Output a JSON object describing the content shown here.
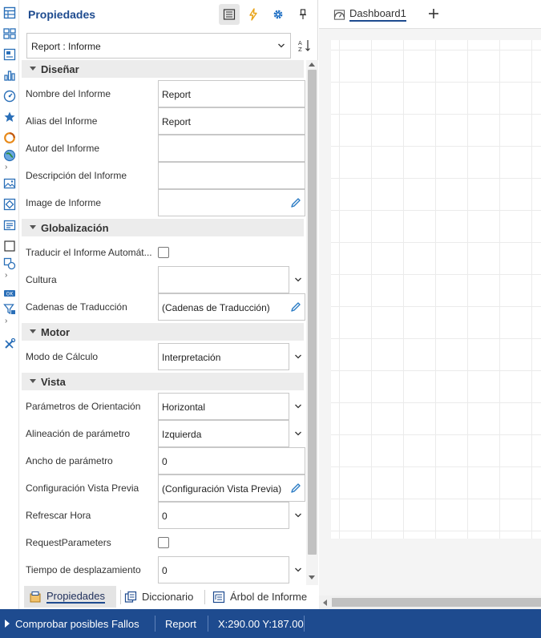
{
  "properties_panel": {
    "title": "Propiedades",
    "object_selector": "Report : Informe",
    "categories": [
      {
        "label": "Diseñar",
        "rows": [
          {
            "label": "Nombre del Informe",
            "value": "Report",
            "editor": "text"
          },
          {
            "label": "Alias del Informe",
            "value": "Report",
            "editor": "text"
          },
          {
            "label": "Autor del Informe",
            "value": "",
            "editor": "text"
          },
          {
            "label": "Descripción del Informe",
            "value": "",
            "editor": "text"
          },
          {
            "label": "Image de Informe",
            "value": "",
            "editor": "pencil"
          }
        ]
      },
      {
        "label": "Globalización",
        "rows": [
          {
            "label": "Traducir el Informe Automát...",
            "value": "",
            "editor": "checkbox",
            "checked": false
          },
          {
            "label": "Cultura",
            "value": "",
            "editor": "dropdown"
          },
          {
            "label": "Cadenas de Traducción",
            "value": "(Cadenas de Traducción)",
            "editor": "pencil"
          }
        ]
      },
      {
        "label": "Motor",
        "rows": [
          {
            "label": "Modo de Cálculo",
            "value": "Interpretación",
            "editor": "dropdown"
          }
        ]
      },
      {
        "label": "Vista",
        "rows": [
          {
            "label": "Parámetros de Orientación",
            "value": "Horizontal",
            "editor": "dropdown"
          },
          {
            "label": "Alineación de parámetro",
            "value": "Izquierda",
            "editor": "dropdown"
          },
          {
            "label": "Ancho de parámetro",
            "value": "0",
            "editor": "text"
          },
          {
            "label": "Configuración Vista Previa",
            "value": "(Configuración Vista Previa)",
            "editor": "pencil"
          },
          {
            "label": "Refrescar Hora",
            "value": "0",
            "editor": "dropdown"
          },
          {
            "label": "RequestParameters",
            "value": "",
            "editor": "checkbox",
            "checked": false
          },
          {
            "label": "Tiempo de desplazamiento",
            "value": "0",
            "editor": "dropdown"
          }
        ]
      }
    ],
    "bottom_tabs": [
      "Propiedades",
      "Diccionario",
      "Árbol de Informe"
    ]
  },
  "designer": {
    "tab_label": "Dashboard1"
  },
  "statusbar": {
    "check_label": "Comprobar posibles Fallos",
    "report_label": "Report",
    "coords": "X:290.00 Y:187.00"
  },
  "colors": {
    "accent": "#1e4b8f",
    "toolbar_icon": "#2a6fb8",
    "category_bg": "#ececec",
    "pencil": "#2a7bc4",
    "event_icon": "#e8a317"
  }
}
